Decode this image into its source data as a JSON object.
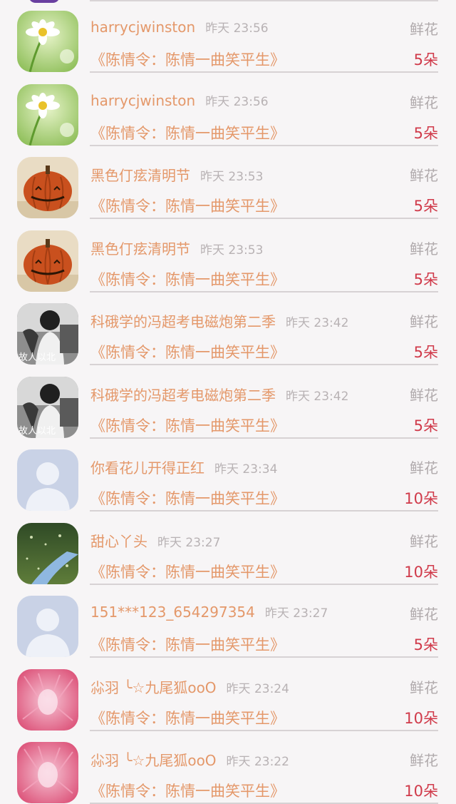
{
  "records": [
    {
      "avatar": "daisy-avatar",
      "name": "harrycjwinston",
      "time": "昨天 23:56",
      "gift": "鲜花",
      "drama": "《陈情令：陈情一曲笑平生》",
      "count": "5朵"
    },
    {
      "avatar": "daisy-avatar",
      "name": "harrycjwinston",
      "time": "昨天 23:56",
      "gift": "鲜花",
      "drama": "《陈情令：陈情一曲笑平生》",
      "count": "5朵"
    },
    {
      "avatar": "pumpkin-avatar",
      "name": "黑色仃痃清明节",
      "time": "昨天 23:53",
      "gift": "鲜花",
      "drama": "《陈情令：陈情一曲笑平生》",
      "count": "5朵"
    },
    {
      "avatar": "pumpkin-avatar",
      "name": "黑色仃痃清明节",
      "time": "昨天 23:53",
      "gift": "鲜花",
      "drama": "《陈情令：陈情一曲笑平生》",
      "count": "5朵"
    },
    {
      "avatar": "photo-avatar",
      "avatar_text": "故人以北",
      "name": "科硪学的冯超考电磁炮第二季",
      "time": "昨天 23:42",
      "gift": "鲜花",
      "drama": "《陈情令：陈情一曲笑平生》",
      "count": "5朵"
    },
    {
      "avatar": "photo-avatar",
      "avatar_text": "故人以北",
      "name": "科硪学的冯超考电磁炮第二季",
      "time": "昨天 23:42",
      "gift": "鲜花",
      "drama": "《陈情令：陈情一曲笑平生》",
      "count": "5朵"
    },
    {
      "avatar": "default-user-avatar",
      "name": "你看花儿开得正红",
      "time": "昨天 23:34",
      "gift": "鲜花",
      "drama": "《陈情令：陈情一曲笑平生》",
      "count": "10朵"
    },
    {
      "avatar": "stream-avatar",
      "name": "甜心丫头",
      "time": "昨天 23:27",
      "gift": "鲜花",
      "drama": "《陈情令：陈情一曲笑平生》",
      "count": "10朵"
    },
    {
      "avatar": "default-user-avatar",
      "name": "151***123_654297354",
      "time": "昨天 23:27",
      "gift": "鲜花",
      "drama": "《陈情令：陈情一曲笑平生》",
      "count": "5朵"
    },
    {
      "avatar": "pink-avatar",
      "name": "尛羽 ╰☆九尾狐ooO",
      "time": "昨天 23:24",
      "gift": "鲜花",
      "drama": "《陈情令：陈情一曲笑平生》",
      "count": "10朵"
    },
    {
      "avatar": "pink-avatar",
      "name": "尛羽 ╰☆九尾狐ooO",
      "time": "昨天 23:22",
      "gift": "鲜花",
      "drama": "《陈情令：陈情一曲笑平生》",
      "count": "10朵"
    }
  ],
  "colors": {
    "name": "#e4986a",
    "time": "#b8b2b4",
    "gift": "#b0aaac",
    "count": "#d03a4a",
    "background": "#f7f5f6"
  }
}
